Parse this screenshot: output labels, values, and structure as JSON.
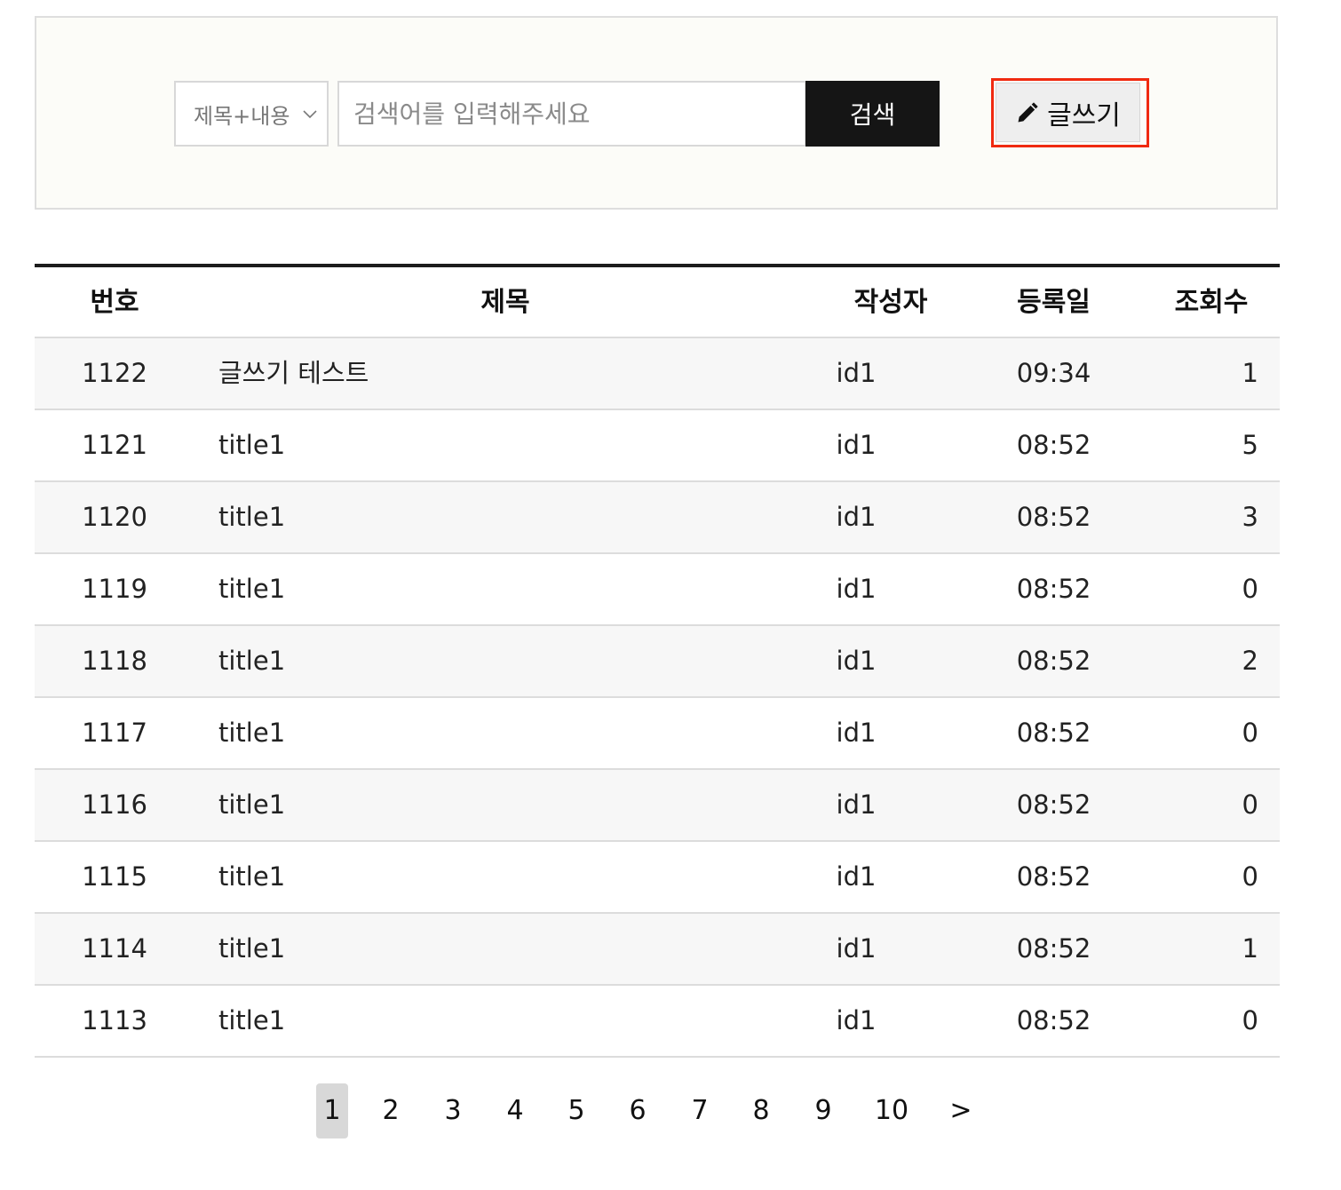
{
  "search": {
    "filter_value": "제목+내용",
    "placeholder": "검색어를 입력해주세요",
    "button_label": "검색"
  },
  "write_button": {
    "label": "글쓰기",
    "icon": "pencil-icon",
    "highlight_color": "#f02a10"
  },
  "table": {
    "headers": {
      "number": "번호",
      "title": "제목",
      "author": "작성자",
      "date": "등록일",
      "views": "조회수"
    },
    "rows": [
      {
        "number": "1122",
        "title": "글쓰기 테스트",
        "author": "id1",
        "date": "09:34",
        "views": "1"
      },
      {
        "number": "1121",
        "title": "title1",
        "author": "id1",
        "date": "08:52",
        "views": "5"
      },
      {
        "number": "1120",
        "title": "title1",
        "author": "id1",
        "date": "08:52",
        "views": "3"
      },
      {
        "number": "1119",
        "title": "title1",
        "author": "id1",
        "date": "08:52",
        "views": "0"
      },
      {
        "number": "1118",
        "title": "title1",
        "author": "id1",
        "date": "08:52",
        "views": "2"
      },
      {
        "number": "1117",
        "title": "title1",
        "author": "id1",
        "date": "08:52",
        "views": "0"
      },
      {
        "number": "1116",
        "title": "title1",
        "author": "id1",
        "date": "08:52",
        "views": "0"
      },
      {
        "number": "1115",
        "title": "title1",
        "author": "id1",
        "date": "08:52",
        "views": "0"
      },
      {
        "number": "1114",
        "title": "title1",
        "author": "id1",
        "date": "08:52",
        "views": "1"
      },
      {
        "number": "1113",
        "title": "title1",
        "author": "id1",
        "date": "08:52",
        "views": "0"
      }
    ]
  },
  "pagination": {
    "pages": [
      "1",
      "2",
      "3",
      "4",
      "5",
      "6",
      "7",
      "8",
      "9",
      "10"
    ],
    "current": "1",
    "next_label": ">"
  }
}
